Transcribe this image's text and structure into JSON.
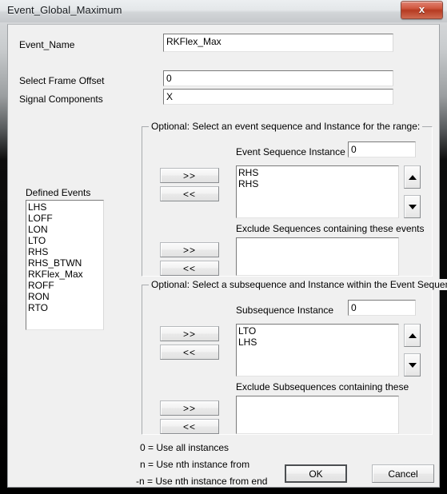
{
  "window": {
    "title": "Event_Global_Maximum",
    "close_glyph": "x",
    "close_label": "Close"
  },
  "fields": {
    "event_name": {
      "label": "Event_Name",
      "value": "RKFlex_Max"
    },
    "frame_offset": {
      "label": "Select Frame Offset",
      "value": "0"
    },
    "signal_components": {
      "label": "Signal Components",
      "value": "X"
    }
  },
  "defined_events": {
    "label": "Defined Events",
    "items": [
      "LHS",
      "LOFF",
      "LON",
      "LTO",
      "RHS",
      "RHS_BTWN",
      "RKFlex_Max",
      "ROFF",
      "RON",
      "RTO"
    ]
  },
  "sequence_group": {
    "title": "Optional: Select an event sequence and Instance for the range:",
    "instance_label": "Event Sequence Instance",
    "instance_value": "0",
    "sequence_items": [
      "RHS",
      "RHS"
    ],
    "exclude_label": "Exclude Sequences containing these events",
    "exclude_items": [],
    "add_button": ">>",
    "remove_button": "<<",
    "exclude_add_button": ">>",
    "exclude_remove_button": "<<",
    "scroll_up": "up-arrow",
    "scroll_down": "down-arrow"
  },
  "subsequence_group": {
    "title": "Optional: Select a subsequence and Instance within the Event Sequence",
    "instance_label": "Subsequence Instance",
    "instance_value": "0",
    "subsequence_items": [
      "LTO",
      "LHS"
    ],
    "exclude_label": "Exclude Subsequences containing these",
    "exclude_items": [],
    "add_button": ">>",
    "remove_button": "<<",
    "exclude_add_button": ">>",
    "exclude_remove_button": "<<",
    "scroll_up": "up-arrow",
    "scroll_down": "down-arrow"
  },
  "hints": [
    "0 = Use all instances",
    "n = Use nth instance from",
    "-n = Use nth instance from end"
  ],
  "buttons": {
    "ok": "OK",
    "cancel": "Cancel"
  },
  "colors": {
    "dialog_bg": "#f0f0f0",
    "close_red": "#b63b22",
    "field_bg": "#ffffff",
    "frame_black": "#000000"
  }
}
